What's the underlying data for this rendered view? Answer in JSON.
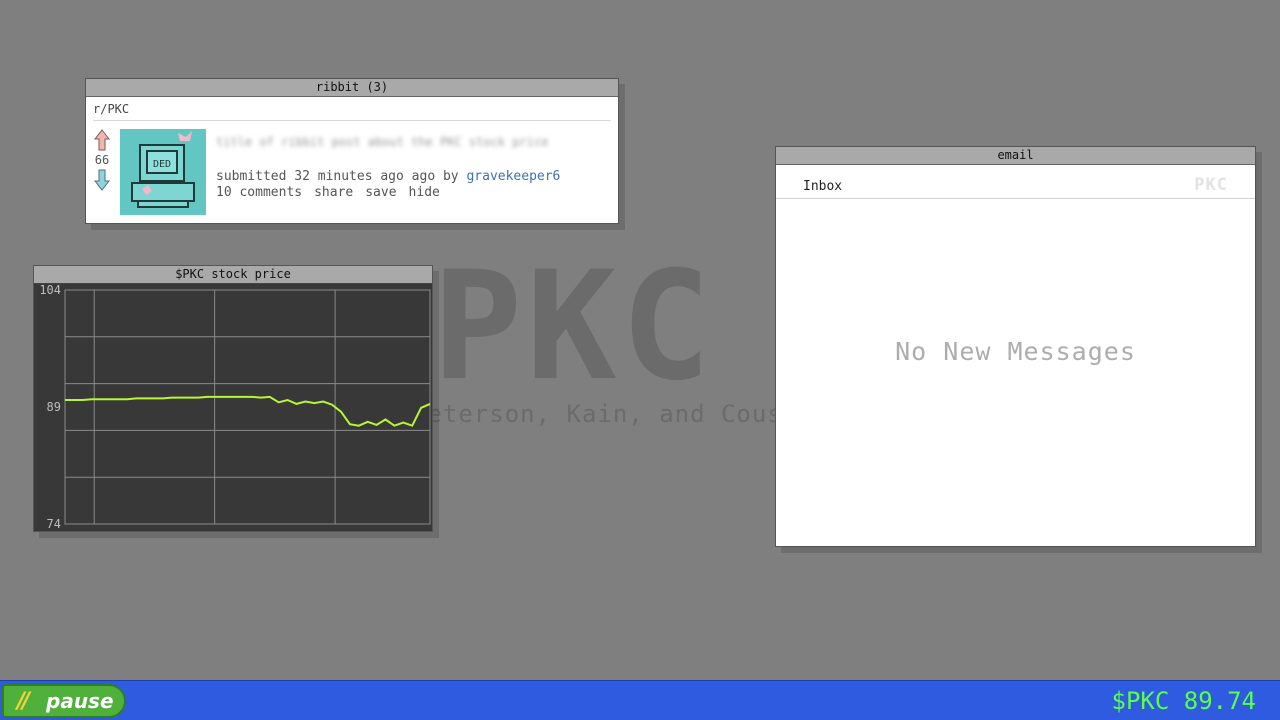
{
  "wallpaper": {
    "logo": "PKC",
    "tagline": "Peterson, Kain, and Cousins"
  },
  "ribbit": {
    "window_title": "ribbit (3)",
    "subreddit": "r/PKC",
    "post": {
      "score": "66",
      "thumbnail_text": "DED",
      "title": "title of ribbit post about the PKC stock price",
      "meta_prefix": "submitted 32 minutes ago ago by",
      "author": "gravekeeper6",
      "actions": [
        "10 comments",
        "share",
        "save",
        "hide"
      ]
    },
    "upvote_color": "#f2b6b0",
    "downvote_color": "#8fd3dd"
  },
  "stock": {
    "window_title": "$PKC stock price",
    "line_color": "#b8f534"
  },
  "chart_data": {
    "type": "line",
    "title": "$PKC stock price",
    "xlabel": "",
    "ylabel": "",
    "ylim": [
      74,
      104
    ],
    "y_ticks": [
      "104",
      "89",
      "74"
    ],
    "grid": true,
    "series": [
      {
        "values": [
          89.9,
          89.9,
          89.9,
          90.0,
          90.0,
          90.0,
          90.0,
          90.0,
          90.1,
          90.1,
          90.1,
          90.1,
          90.2,
          90.2,
          90.2,
          90.2,
          90.3,
          90.3,
          90.3,
          90.3,
          90.3,
          90.3,
          90.2,
          90.3,
          89.6,
          89.9,
          89.4,
          89.7,
          89.5,
          89.7,
          89.3,
          88.4,
          86.8,
          86.6,
          87.1,
          86.7,
          87.4,
          86.6,
          87.0,
          86.6,
          88.9,
          89.4
        ]
      }
    ]
  },
  "email": {
    "window_title": "email",
    "inbox_label": "Inbox",
    "logo": "PKC",
    "empty_message": "No New Messages"
  },
  "taskbar": {
    "pause_icon": "//",
    "pause_label": "pause",
    "ticker": "$PKC 89.74",
    "bar_color": "#2e5bdf",
    "ticker_color": "#5aff4a"
  }
}
